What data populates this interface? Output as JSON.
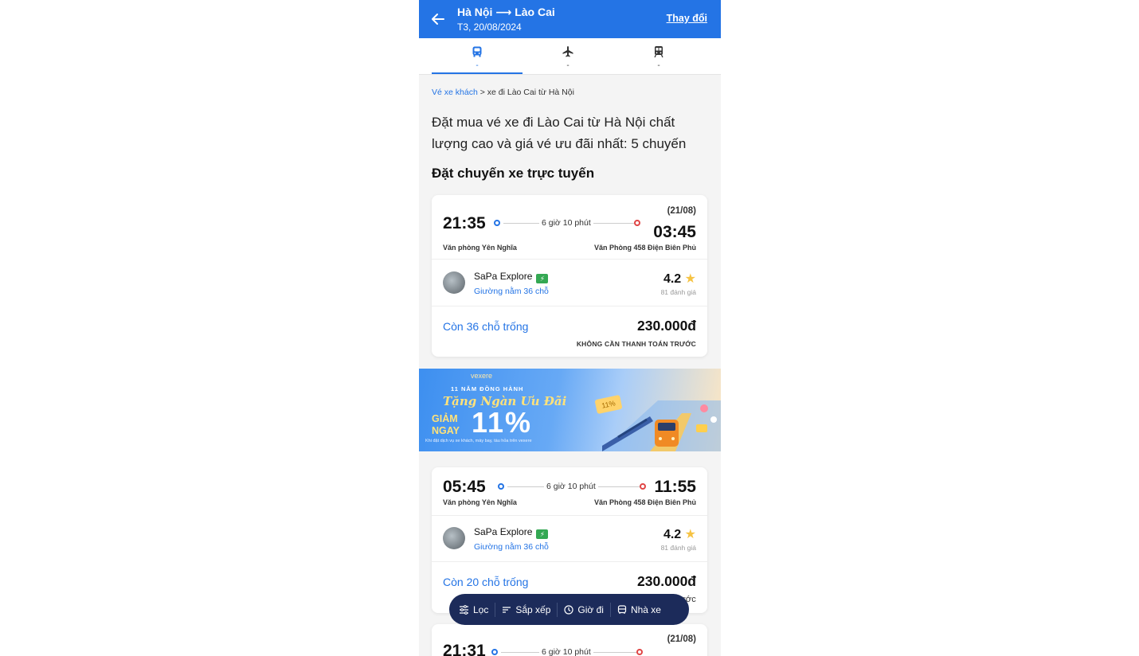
{
  "header": {
    "route": "Hà Nội ⟶ Lào Cai",
    "date": "T3, 20/08/2024",
    "change_label": "Thay đổi"
  },
  "tabs": [
    {
      "icon": "bus-icon",
      "label": "-"
    },
    {
      "icon": "plane-icon",
      "label": "-"
    },
    {
      "icon": "train-icon",
      "label": "-"
    }
  ],
  "breadcrumb": {
    "link": "Vé xe khách",
    "current": "> xe đi Lào Cai từ Hà Nội"
  },
  "page_title": "Đặt mua vé xe đi Lào Cai từ Hà Nội chất lượng cao và giá vé ưu đãi nhất: 5 chuyến",
  "section_title": "Đặt chuyến xe trực tuyến",
  "trips": [
    {
      "depart": "21:35",
      "arrive": "03:45",
      "next_day": "(21/08)",
      "duration": "6 giờ 10 phút",
      "from": "Văn phòng Yên Nghĩa",
      "to": "Văn Phòng 458 Điện Biên Phủ",
      "operator": "SaPa Explore",
      "seat_type": "Giường nằm 36 chỗ",
      "rating": "4.2",
      "reviews": "81 đánh giá",
      "seats_left": "Còn 36 chỗ trống",
      "price": "230.000đ",
      "pay_note": "KHÔNG CẦN THANH TOÁN TRƯỚC"
    },
    {
      "depart": "05:45",
      "arrive": "11:55",
      "duration": "6 giờ 10 phút",
      "from": "Văn phòng Yên Nghĩa",
      "to": "Văn Phòng 458 Điện Biên Phủ",
      "operator": "SaPa Explore",
      "seat_type": "Giường nằm 36 chỗ",
      "rating": "4.2",
      "reviews": "81 đánh giá",
      "seats_left": "Còn 20 chỗ trống",
      "price": "230.000đ",
      "pay_note_visible": "ước"
    },
    {
      "depart": "21:31",
      "next_day": "(21/08)",
      "duration": "6 giờ 10 phút"
    }
  ],
  "banner": {
    "logo": "vexere",
    "years": "11 NĂM ĐỒNG HÀNH",
    "gift": "Tặng Ngàn Ưu Đãi",
    "discount_word": "GIẢM NGAY",
    "discount_value": "11%",
    "tag": "11%",
    "fineprint": "Khi đặt dịch vụ xe khách, máy bay, tàu hỏa trên vexere"
  },
  "filter_bar": [
    {
      "icon": "filter-icon",
      "label": "Lọc"
    },
    {
      "icon": "sort-icon",
      "label": "Sắp xếp"
    },
    {
      "icon": "clock-icon",
      "label": "Giờ đi"
    },
    {
      "icon": "bus-icon",
      "label": "Nhà xe"
    }
  ],
  "colors": {
    "primary": "#2474e5",
    "header_bg": "#2474e5",
    "filter_bar_bg": "#1c2b5a",
    "destination_dot": "#e04646",
    "star": "#f6c343",
    "badge": "#34a853"
  }
}
